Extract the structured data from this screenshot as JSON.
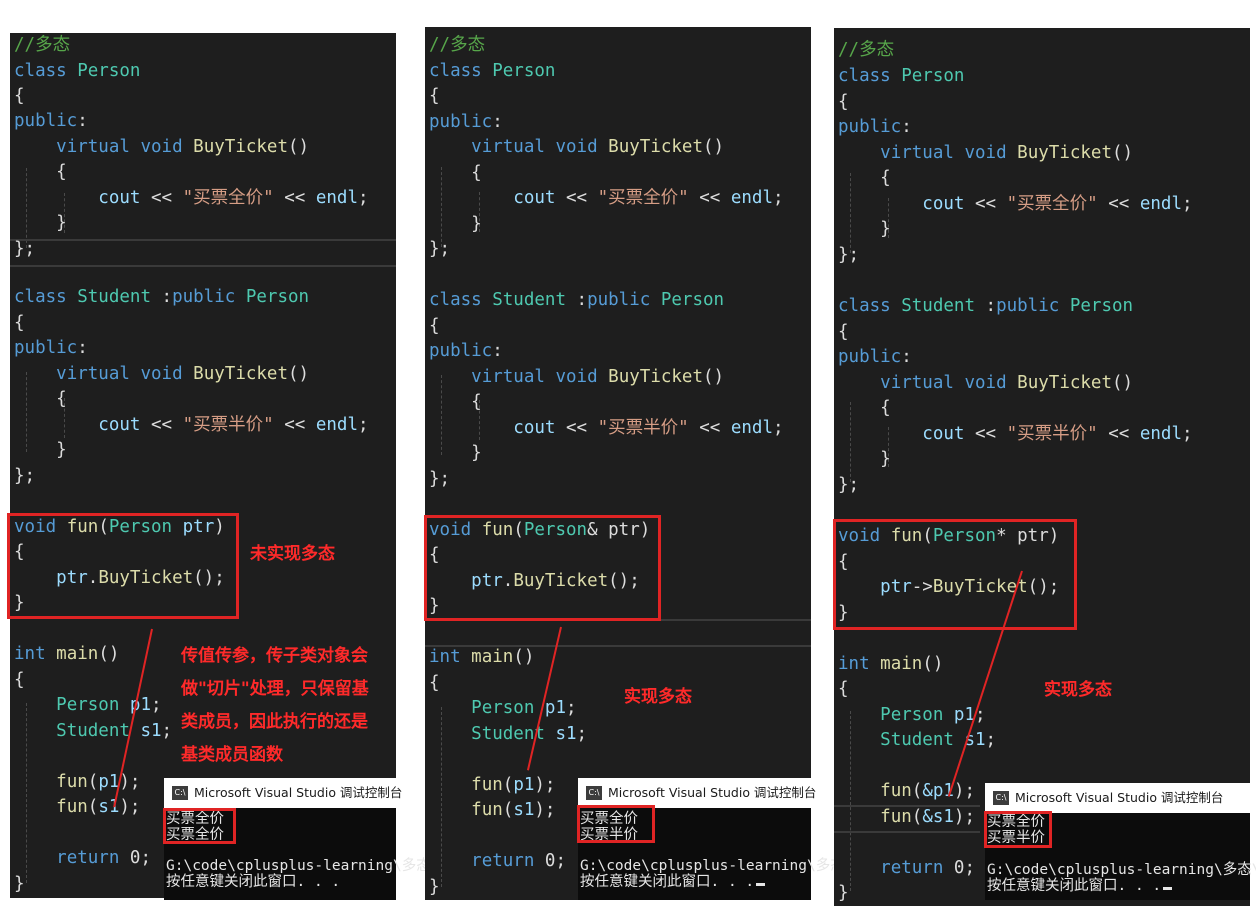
{
  "code": {
    "comment": "//多态",
    "kw_class": "class",
    "kw_public": "public",
    "kw_virtual": "virtual",
    "kw_void": "void",
    "kw_int": "int",
    "kw_return": "return",
    "type_person": "Person",
    "type_student": "Student",
    "fn_buyticket": "BuyTicket",
    "fn_fun": "fun",
    "fn_main": "main",
    "id_cout": "cout",
    "id_endl": "endl",
    "id_ptr": "ptr",
    "id_p1": "p1",
    "id_s1": "s1",
    "zero": "0",
    "str_full": "\"买票全价\"",
    "str_half": "\"买票半价\"",
    "amp_p1": "&p1",
    "amp_s1": "&s1"
  },
  "panels": [
    {
      "param_sig": "ptr)",
      "call_sep": ".",
      "fun_call_1": "p1",
      "fun_call_2": "s1",
      "output_line1": "买票全价",
      "output_line2": "买票全价",
      "annotation_box": "未实现多态",
      "annotation_note": [
        "传值传参，传子类对象会",
        "做\"切片\"处理，只保留基",
        "类成员，因此执行的还是",
        "基类成员函数"
      ]
    },
    {
      "param_sig": "& ptr)",
      "call_sep": ".",
      "fun_call_1": "p1",
      "fun_call_2": "s1",
      "output_line1": "买票全价",
      "output_line2": "买票半价",
      "annotation_note": [
        "实现多态"
      ]
    },
    {
      "param_sig": "* ptr)",
      "call_sep": "->",
      "fun_call_1": "&p1",
      "fun_call_2": "&s1",
      "output_line1": "买票全价",
      "output_line2": "买票半价",
      "annotation_note": [
        "实现多态"
      ]
    }
  ],
  "console": {
    "title": "Microsoft Visual Studio 调试控制台",
    "icon": "visual-studio-icon",
    "icon_text": "C:\\",
    "path_1": "G:\\code\\cplusplus-learning\\多态",
    "path_3": "G:\\code\\cplusplus-learning\\多态\\x",
    "close_prompt": "按任意键关闭此窗口. . ."
  },
  "colors": {
    "editor_bg": "#1e1e1e",
    "keyword": "#569cd6",
    "type": "#4ec9b0",
    "function": "#dcdcaa",
    "string": "#d69d85",
    "comment": "#57a64a",
    "identifier": "#9cdcfe",
    "annotation_red": "#e02424"
  }
}
